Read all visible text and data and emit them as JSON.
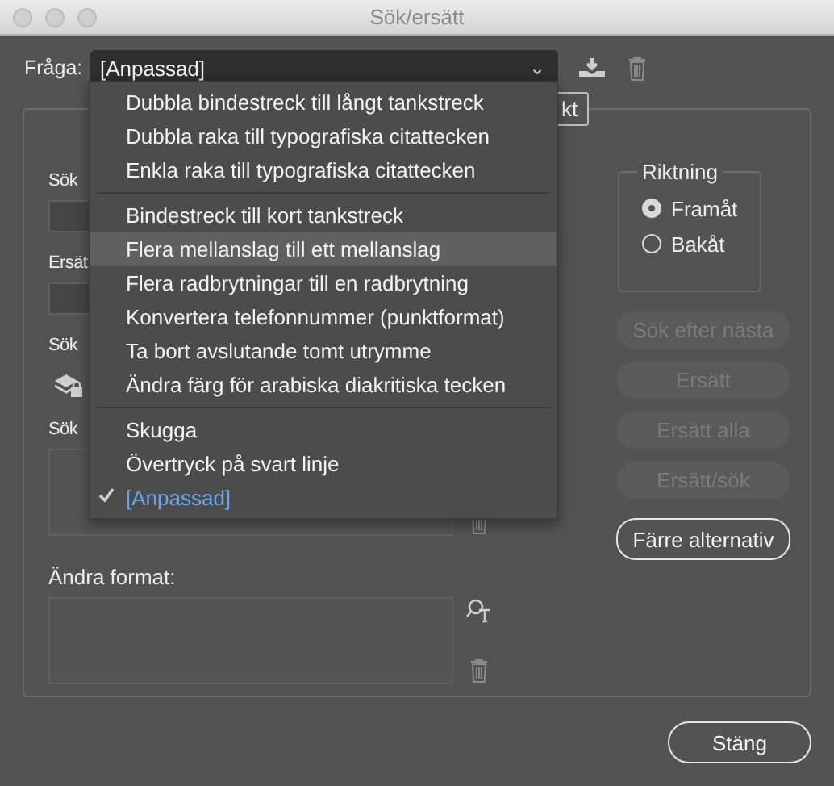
{
  "window": {
    "title": "Sök/ersätt"
  },
  "query": {
    "label": "Fråga:",
    "value": "[Anpassad]",
    "caret": "⌄"
  },
  "query_menu": {
    "items": [
      {
        "label": "Dubbla bindestreck till långt tankstreck",
        "highlighted": false,
        "checked": false,
        "separator_before": false
      },
      {
        "label": "Dubbla raka till typografiska citattecken",
        "highlighted": false,
        "checked": false,
        "separator_before": false
      },
      {
        "label": "Enkla raka till typografiska citattecken",
        "highlighted": false,
        "checked": false,
        "separator_before": false
      },
      {
        "label": "Bindestreck till kort tankstreck",
        "highlighted": false,
        "checked": false,
        "separator_before": true
      },
      {
        "label": "Flera mellanslag till ett mellanslag",
        "highlighted": true,
        "checked": false,
        "separator_before": false
      },
      {
        "label": "Flera radbrytningar till en radbrytning",
        "highlighted": false,
        "checked": false,
        "separator_before": false
      },
      {
        "label": "Konvertera telefonnummer (punktformat)",
        "highlighted": false,
        "checked": false,
        "separator_before": false
      },
      {
        "label": "Ta bort avslutande tomt utrymme",
        "highlighted": false,
        "checked": false,
        "separator_before": false
      },
      {
        "label": "Ändra färg för arabiska diakritiska tecken",
        "highlighted": false,
        "checked": false,
        "separator_before": false
      },
      {
        "label": "Skugga",
        "highlighted": false,
        "checked": false,
        "separator_before": true
      },
      {
        "label": "Övertryck på svart linje",
        "highlighted": false,
        "checked": false,
        "separator_before": false
      },
      {
        "label": "[Anpassad]",
        "highlighted": false,
        "checked": true,
        "separator_before": false
      }
    ]
  },
  "tab": {
    "label": "kt"
  },
  "form": {
    "labels": [
      "Sök",
      "Ersät",
      "Sök",
      "Sök"
    ],
    "change_format_label": "Ändra format:"
  },
  "direction": {
    "title": "Riktning",
    "options": [
      {
        "label": "Framåt",
        "selected": true
      },
      {
        "label": "Bakåt",
        "selected": false
      }
    ]
  },
  "actions": [
    {
      "label": "Sök efter nästa",
      "disabled": true
    },
    {
      "label": "Ersätt",
      "disabled": true
    },
    {
      "label": "Ersätt alla",
      "disabled": true
    },
    {
      "label": "Ersätt/sök",
      "disabled": true
    },
    {
      "label": "Färre alternativ",
      "disabled": false
    }
  ],
  "close_button": "Stäng"
}
